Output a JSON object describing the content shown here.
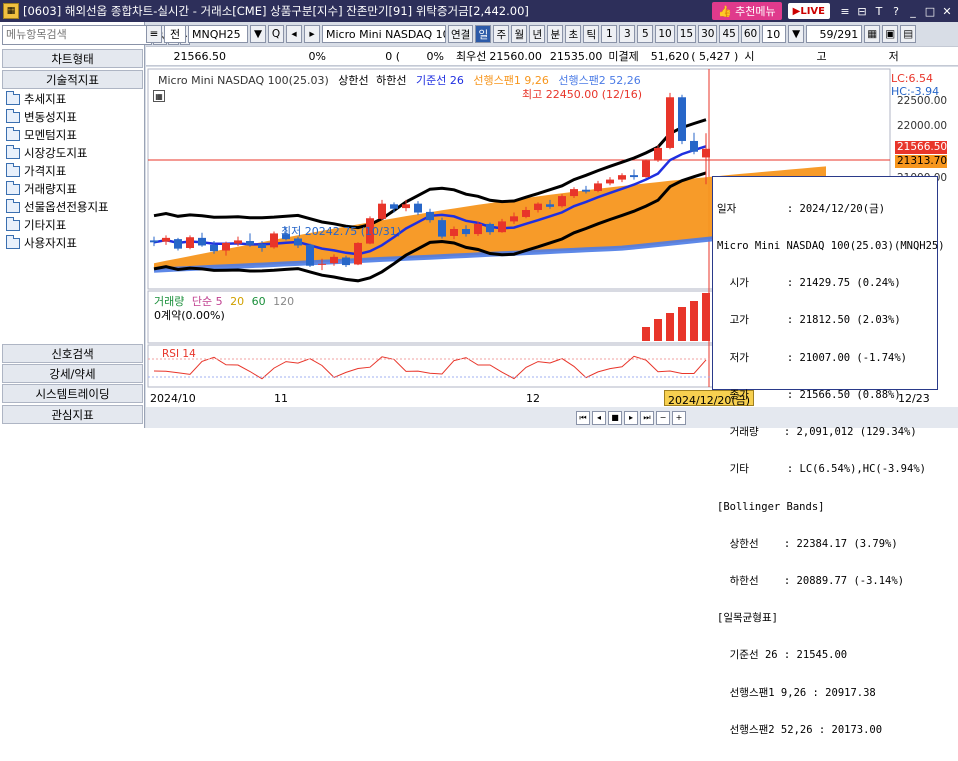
{
  "window": {
    "title": "[0603] 해외선옵 종합차트-실시간 - 거래소[CME] 상품구분[지수] 잔존만기[91] 위탁증거금[2,442.00]",
    "recommend_label": "추천메뉴",
    "live_label": "LIVE",
    "icon_label": "0603"
  },
  "left": {
    "search_placeholder": "메뉴항목검색",
    "buttons_top": [
      "차트형태",
      "기술적지표"
    ],
    "tree": [
      "추세지표",
      "변동성지표",
      "모멘텀지표",
      "시장강도지표",
      "가격지표",
      "거래량지표",
      "선물옵션전용지표",
      "기타지표",
      "사용자지표"
    ],
    "buttons_bottom": [
      "신호검색",
      "강세/약세",
      "시스템트레이딩",
      "관심지표"
    ]
  },
  "toolbar": {
    "prefix": "전",
    "symbol": "MNQH25",
    "name": "Micro Mini NASDAQ 10",
    "link": "연결",
    "periods": [
      "일",
      "주",
      "월",
      "년",
      "분",
      "초",
      "틱"
    ],
    "selected_period": "일",
    "intervals": [
      "1",
      "3",
      "5",
      "10",
      "15",
      "30",
      "45",
      "60"
    ],
    "interval_value": "10",
    "page": "59/291"
  },
  "quote": {
    "price": "21566.50",
    "change_pct": "0%",
    "vol": "0 (",
    "vol_pct": "0%",
    "best_ask_label": "최우선",
    "best_ask": "21560.00",
    "best_bid": "21535.00",
    "unsettled_label": "미결제",
    "unsettled": "51,620",
    "unsettled_chg": "( 5,427 )",
    "ohlc_labels": [
      "시",
      "고",
      "저"
    ]
  },
  "chart": {
    "legend": {
      "name": "Micro Mini NASDAQ 100(25.03)",
      "upper": "상한선",
      "lower": "하한선",
      "base": "기준선 26",
      "span1": "선행스팬1 9,26",
      "span2": "선행스팬2 52,26"
    },
    "high_label": "최고 22450.00 (12/16)",
    "low_label": "최저 20242.75 (10/31)",
    "lc_label": "LC:6.54",
    "hc_label": "HC:-3.94",
    "price_ticks": [
      "22500.00",
      "22000.00",
      "21000.00"
    ],
    "current_price_tag": "21566.50",
    "current_price_tag2": "21313.70",
    "volume_legend": {
      "name": "거래량",
      "simple": "단순 5",
      "p20": "20",
      "p60": "60",
      "p120": "120"
    },
    "oi_label": "0계약(0.00%)",
    "rsi_label": "RSI 14",
    "x_labels": [
      "2024/10",
      "11",
      "12",
      "12/23"
    ],
    "cursor_date": "2024/12/20(금)",
    "colors": {
      "up": "#e8352a",
      "down": "#2766c8",
      "band": "#000000",
      "mid": "#1f2fe0",
      "cloud": "#f7961d",
      "span2": "#4b7be6"
    }
  },
  "chart_data": {
    "type": "candlestick",
    "title": "Micro Mini NASDAQ 100(25.03)",
    "ylim": [
      19700,
      22700
    ],
    "candles": [
      [
        20120,
        20180,
        20030,
        20090
      ],
      [
        20100,
        20200,
        20050,
        20160
      ],
      [
        20140,
        20160,
        19960,
        19990
      ],
      [
        20000,
        20200,
        19980,
        20170
      ],
      [
        20160,
        20240,
        20020,
        20040
      ],
      [
        20050,
        20110,
        19910,
        19950
      ],
      [
        19960,
        20100,
        19880,
        20080
      ],
      [
        20070,
        20180,
        20030,
        20120
      ],
      [
        20110,
        20230,
        20020,
        20050
      ],
      [
        20060,
        20110,
        19940,
        20000
      ],
      [
        20010,
        20260,
        19990,
        20230
      ],
      [
        20220,
        20320,
        20120,
        20140
      ],
      [
        20150,
        20180,
        20000,
        20040
      ],
      [
        20050,
        20070,
        19700,
        19720
      ],
      [
        19740,
        19830,
        19650,
        19750
      ],
      [
        19760,
        19900,
        19720,
        19860
      ],
      [
        19850,
        19880,
        19700,
        19730
      ],
      [
        19740,
        20090,
        19730,
        20080
      ],
      [
        20070,
        20500,
        20060,
        20470
      ],
      [
        20460,
        20760,
        20440,
        20700
      ],
      [
        20690,
        20720,
        20560,
        20620
      ],
      [
        20630,
        20760,
        20580,
        20690
      ],
      [
        20700,
        20740,
        20520,
        20560
      ],
      [
        20570,
        20620,
        20400,
        20440
      ],
      [
        20440,
        20480,
        20150,
        20180
      ],
      [
        20190,
        20340,
        20140,
        20300
      ],
      [
        20300,
        20360,
        20180,
        20220
      ],
      [
        20220,
        20420,
        20190,
        20380
      ],
      [
        20380,
        20400,
        20210,
        20250
      ],
      [
        20250,
        20460,
        20240,
        20420
      ],
      [
        20420,
        20560,
        20380,
        20500
      ],
      [
        20490,
        20650,
        20470,
        20600
      ],
      [
        20600,
        20720,
        20560,
        20700
      ],
      [
        20690,
        20760,
        20620,
        20650
      ],
      [
        20660,
        20850,
        20640,
        20820
      ],
      [
        20820,
        20960,
        20790,
        20930
      ],
      [
        20920,
        20980,
        20860,
        20890
      ],
      [
        20900,
        21060,
        20880,
        21020
      ],
      [
        21020,
        21120,
        20990,
        21080
      ],
      [
        21080,
        21180,
        21040,
        21150
      ],
      [
        21150,
        21240,
        21080,
        21120
      ],
      [
        21120,
        21400,
        21110,
        21380
      ],
      [
        21380,
        21620,
        21360,
        21580
      ],
      [
        21580,
        22450,
        21560,
        22380
      ],
      [
        22380,
        22420,
        21640,
        21690
      ],
      [
        21690,
        21820,
        21480,
        21520
      ],
      [
        21430,
        21812.5,
        21007,
        21566.5
      ]
    ],
    "selected": {
      "date": "2024/12/20(금)",
      "open": "21429.75",
      "high": "21812.50",
      "low": "21007.00",
      "close": "21566.50",
      "volume": "2,091,012"
    }
  },
  "tooltip": {
    "lines": [
      "일자        : 2024/12/20(금)",
      "Micro Mini NASDAQ 100(25.03)(MNQH25)",
      "  시가      : 21429.75 (0.24%)",
      "  고가      : 21812.50 (2.03%)",
      "  저가      : 21007.00 (-1.74%)",
      "  종가      : 21566.50 (0.88%)",
      "  거래량    : 2,091,012 (129.34%)",
      "  기타      : LC(6.54%),HC(-3.94%)",
      "[Bollinger Bands]",
      "  상한선    : 22384.17 (3.79%)",
      "  하한선    : 20889.77 (-3.14%)",
      "[일목균형표]",
      "  기준선 26 : 21545.00",
      "  선행스팬1 9,26 : 20917.38",
      "  선행스팬2 52,26 : 20173.00"
    ]
  }
}
